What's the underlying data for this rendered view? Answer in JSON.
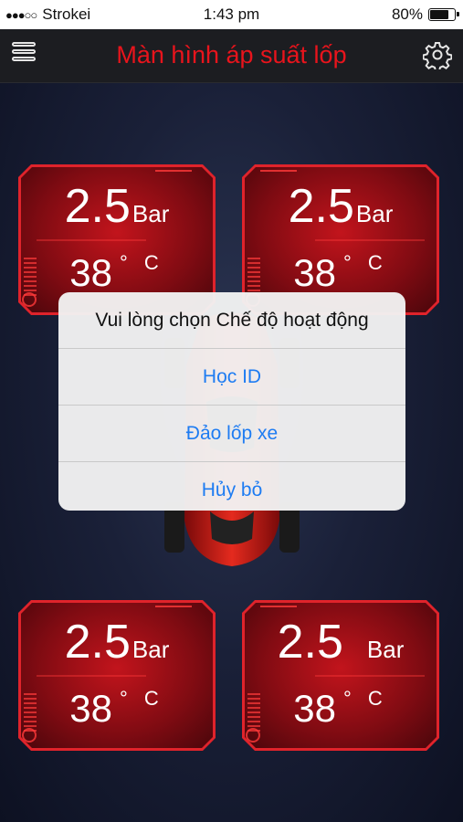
{
  "status_bar": {
    "signal": "●●●○○",
    "carrier": "Strokei",
    "time": "1:43 pm",
    "battery_percent": "80%",
    "battery_level": 0.8
  },
  "nav": {
    "title": "Màn hình áp suất lốp",
    "menu_icon": "hamburger-menu-icon",
    "settings_icon": "gear-icon"
  },
  "tires": [
    {
      "pressure": "2.5",
      "pressure_unit": "Bar",
      "temperature": "38",
      "temp_unit": "° C"
    },
    {
      "pressure": "2.5",
      "pressure_unit": "Bar",
      "temperature": "38",
      "temp_unit": "° C"
    },
    {
      "pressure": "2.5",
      "pressure_unit": "Bar",
      "temperature": "38",
      "temp_unit": "° C"
    },
    {
      "pressure": "2.5",
      "pressure_unit": "Bar",
      "temperature": "38",
      "temp_unit": "° C"
    }
  ],
  "dialog": {
    "title": "Vui lòng chọn Chế độ hoạt động",
    "options": [
      "Học ID",
      "Đảo lốp xe",
      "Hủy bỏ"
    ]
  },
  "colors": {
    "accent_red": "#e8141c",
    "dialog_button_blue": "#1e7cf2"
  }
}
